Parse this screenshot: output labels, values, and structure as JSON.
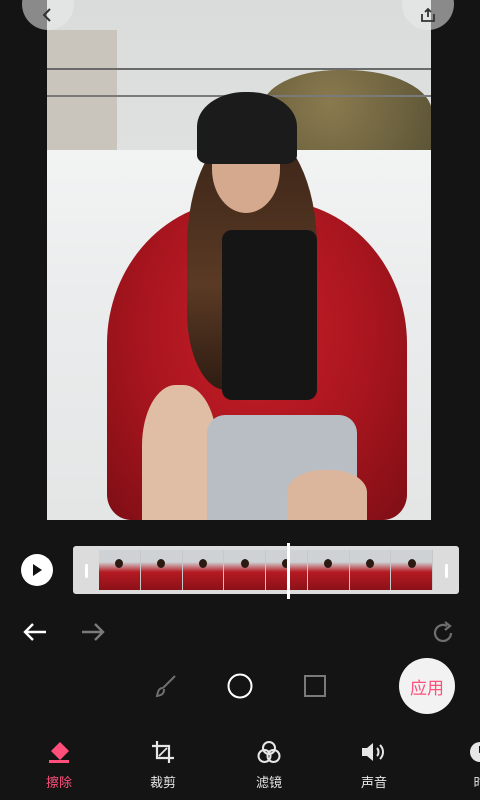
{
  "toolbar": {
    "apply_label": "应用"
  },
  "tabs": [
    {
      "label": "擦除",
      "icon": "eraser-icon",
      "active": true
    },
    {
      "label": "裁剪",
      "icon": "crop-icon",
      "active": false
    },
    {
      "label": "滤镜",
      "icon": "filter-icon",
      "active": false
    },
    {
      "label": "声音",
      "icon": "speaker-icon",
      "active": false
    },
    {
      "label": "时",
      "icon": "clock-icon",
      "active": false
    }
  ],
  "colors": {
    "accent": "#ff4f7a",
    "background": "#141414"
  }
}
